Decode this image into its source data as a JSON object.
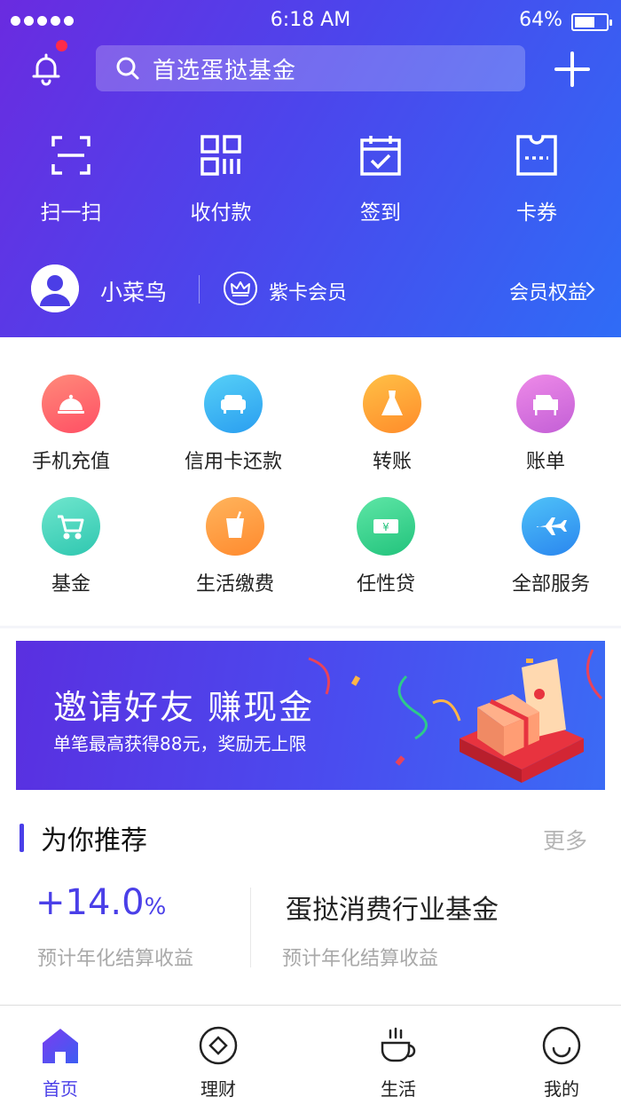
{
  "status_bar": {
    "time": "6:18 AM",
    "battery": "64%",
    "battery_level": 0.64
  },
  "header": {
    "search_placeholder": "首选蛋挞基金",
    "quick_actions": [
      {
        "label": "扫一扫",
        "icon": "scan-icon"
      },
      {
        "label": "收付款",
        "icon": "qr-payment-icon"
      },
      {
        "label": "签到",
        "icon": "calendar-check-icon"
      },
      {
        "label": "卡券",
        "icon": "ticket-icon"
      }
    ],
    "member": {
      "name": "小菜鸟",
      "tier": "紫卡会员",
      "benefits_link": "会员权益"
    }
  },
  "services": [
    {
      "label": "手机充值",
      "icon": "cloche-icon",
      "color": "#ff5e6a"
    },
    {
      "label": "信用卡还款",
      "icon": "sofa-icon",
      "color": "#38b6f2"
    },
    {
      "label": "转账",
      "icon": "dress-icon",
      "color": "#ffa637"
    },
    {
      "label": "账单",
      "icon": "piano-icon",
      "color": "#d86ad8"
    },
    {
      "label": "基金",
      "icon": "cart-icon",
      "color": "#3fd4b8"
    },
    {
      "label": "生活缴费",
      "icon": "drink-icon",
      "color": "#ff9a3c"
    },
    {
      "label": "任性贷",
      "icon": "yen-ticket-icon",
      "color": "#32d088"
    },
    {
      "label": "全部服务",
      "icon": "airplane-icon",
      "color": "#2d9cf0"
    }
  ],
  "banner": {
    "title": "邀请好友 赚现金",
    "subtitle": "单笔最高获得88元，奖励无上限"
  },
  "recommend": {
    "title": "为你推荐",
    "more": "更多",
    "rate": "+14.0",
    "rate_unit": "%",
    "rate_caption": "预计年化结算收益",
    "fund_name": "蛋挞消费行业基金",
    "fund_caption": "预计年化结算收益"
  },
  "tabbar": [
    {
      "label": "首页",
      "icon": "home-icon",
      "active": true
    },
    {
      "label": "理财",
      "icon": "finance-icon",
      "active": false
    },
    {
      "label": "生活",
      "icon": "coffee-cup-icon",
      "active": false
    },
    {
      "label": "我的",
      "icon": "smiley-icon",
      "active": false
    }
  ],
  "colors": {
    "accent": "#4a3fe8",
    "header_gradient_start": "#6a2be0",
    "header_gradient_end": "#2f6cf6"
  }
}
